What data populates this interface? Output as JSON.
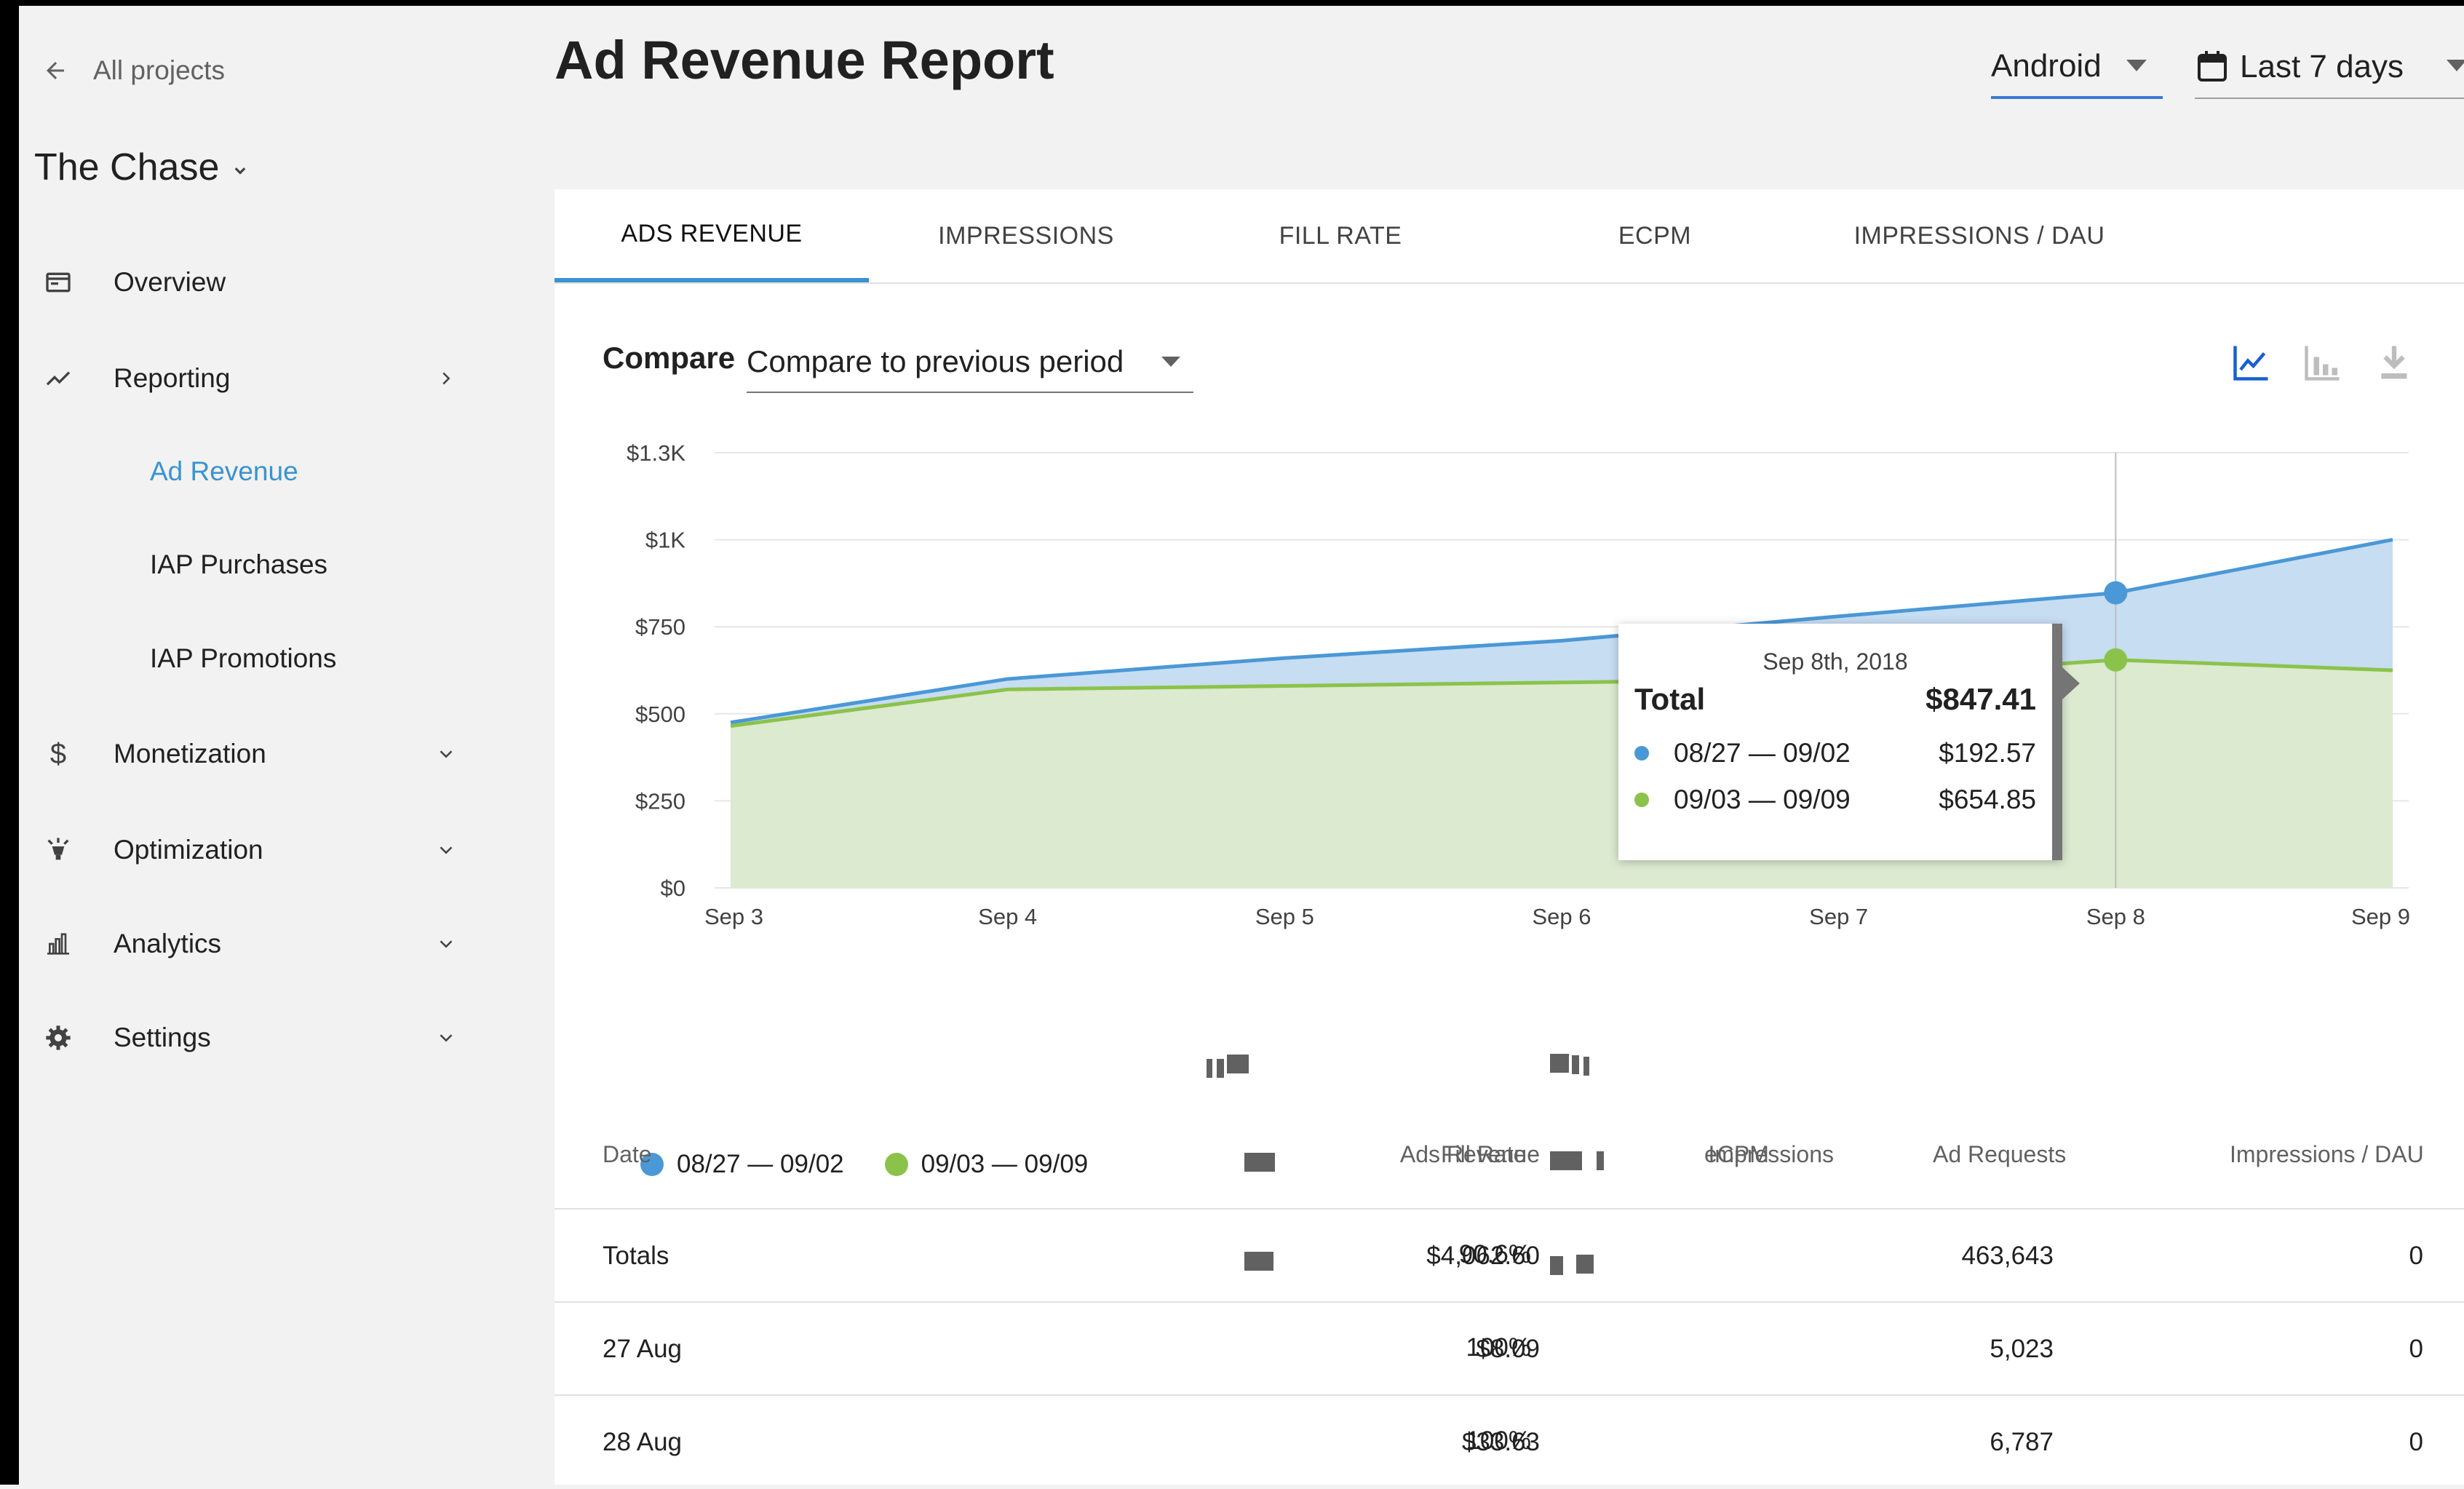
{
  "sidebar": {
    "back_label": "All projects",
    "project_name": "The Chase",
    "items": [
      {
        "label": "Overview",
        "icon": "dashboard-icon"
      },
      {
        "label": "Reporting",
        "icon": "trending-icon"
      },
      {
        "label": "Monetization",
        "icon": "dollar-icon"
      },
      {
        "label": "Optimization",
        "icon": "lamp-icon"
      },
      {
        "label": "Analytics",
        "icon": "bar-chart-icon"
      },
      {
        "label": "Settings",
        "icon": "gear-icon"
      }
    ],
    "sub_items": [
      {
        "label": "Ad Revenue",
        "active": true
      },
      {
        "label": "IAP Purchases",
        "active": false
      },
      {
        "label": "IAP Promotions",
        "active": false
      }
    ]
  },
  "header": {
    "title": "Ad Revenue Report",
    "platform": "Android",
    "date_range": "Last 7 days"
  },
  "tabs": [
    {
      "label": "ADS REVENUE",
      "active": true
    },
    {
      "label": "IMPRESSIONS",
      "active": false
    },
    {
      "label": "FILL RATE",
      "active": false
    },
    {
      "label": "ECPM",
      "active": false
    },
    {
      "label": "IMPRESSIONS / DAU",
      "active": false
    }
  ],
  "compare": {
    "label": "Compare",
    "value": "Compare to previous period"
  },
  "colors": {
    "accent": "#3a93d0",
    "series_previous": "#4a98d6",
    "series_current": "#8bc34a",
    "fill_previous": "#c7ddf1",
    "fill_current": "#dcead0"
  },
  "chart_data": {
    "type": "area",
    "x": [
      "Sep 3",
      "Sep 4",
      "Sep 5",
      "Sep 6",
      "Sep 7",
      "Sep 8",
      "Sep 9"
    ],
    "y_ticks": [
      "$0",
      "$250",
      "$500",
      "$750",
      "$1K",
      "$1.3K"
    ],
    "y_tick_values": [
      0,
      250,
      500,
      750,
      1000,
      1250
    ],
    "ylim": [
      0,
      1250
    ],
    "series": [
      {
        "name": "08/27 — 09/02",
        "values": [
          475,
          600,
          660,
          710,
          780,
          847.41,
          1000
        ]
      },
      {
        "name": "09/03 — 09/09",
        "values": [
          465,
          570,
          580,
          590,
          600,
          654.85,
          625
        ]
      }
    ],
    "grid": true,
    "legend": "bottom-left",
    "tooltip": {
      "date": "Sep 8th, 2018",
      "total_label": "Total",
      "total_value": "$847.41",
      "rows": [
        {
          "label": "08/27 — 09/02",
          "value": "$192.57"
        },
        {
          "label": "09/03 — 09/09",
          "value": "$654.85"
        }
      ]
    }
  },
  "table": {
    "columns": [
      "Date",
      "Ads Revenue",
      "Impressions",
      "Fill Rate",
      "eCPM",
      "Ad Requests",
      "Impressions / DAU"
    ],
    "rows": [
      {
        "date": "Totals",
        "revenue": "$4,062.60",
        "fill": "90.6%",
        "requests": "463,643",
        "imp_dau": "0"
      },
      {
        "date": "27 Aug",
        "revenue": "$8.09",
        "fill": "100%",
        "requests": "5,023",
        "imp_dau": "0"
      },
      {
        "date": "28 Aug",
        "revenue": "$33.63",
        "fill": "100%",
        "requests": "6,787",
        "imp_dau": "0"
      }
    ]
  }
}
